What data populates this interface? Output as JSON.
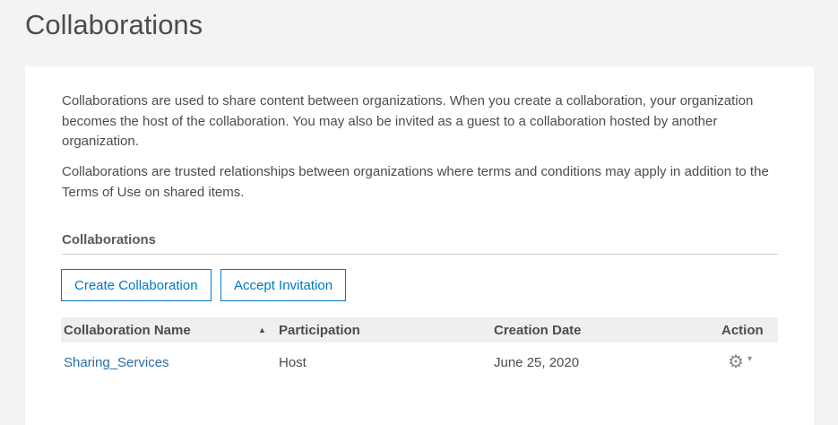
{
  "page_title": "Collaborations",
  "intro": [
    "Collaborations are used to share content between organizations. When you create a collaboration, your organization becomes the host of the collaboration. You may also be invited as a guest to a collaboration hosted by another organization.",
    "Collaborations are trusted relationships between organizations where terms and conditions may apply in addition to the Terms of Use on shared items."
  ],
  "section_title": "Collaborations",
  "buttons": {
    "create": "Create Collaboration",
    "accept": "Accept Invitation"
  },
  "table": {
    "headers": [
      "Collaboration Name",
      "Participation",
      "Creation Date",
      "Action"
    ],
    "sort_icon": "▲",
    "rows": [
      {
        "name": "Sharing_Services",
        "participation": "Host",
        "date": "June 25, 2020",
        "action_icon": "⚙",
        "caret": "▾"
      }
    ]
  }
}
